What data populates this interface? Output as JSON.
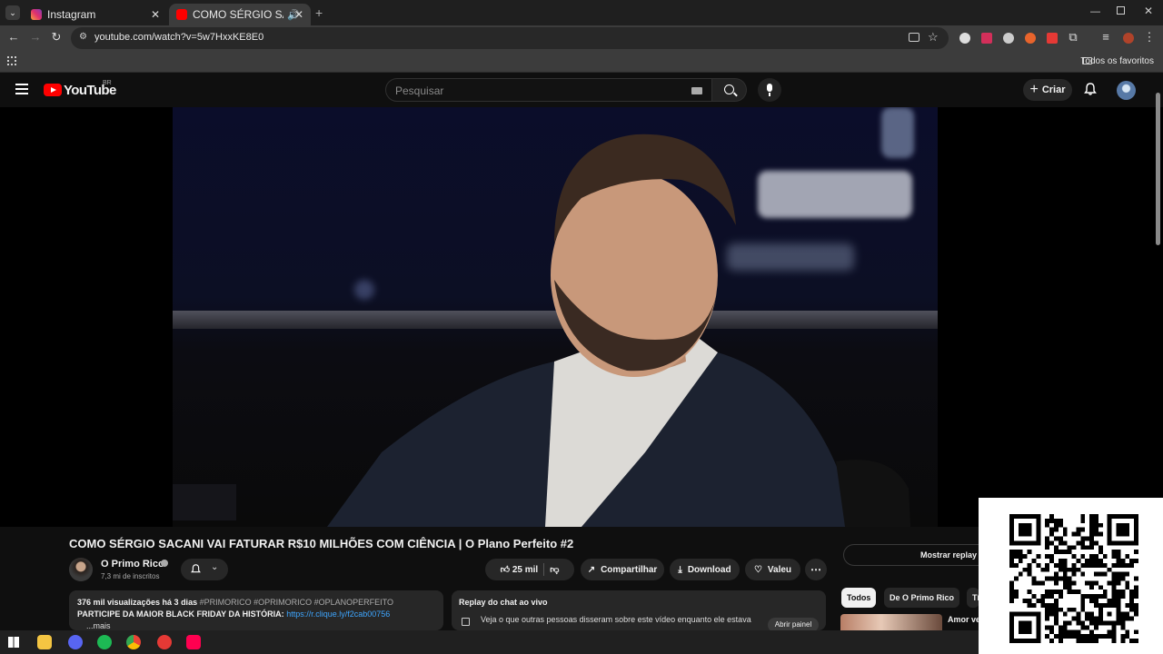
{
  "browser": {
    "tabs": [
      {
        "title": "Instagram",
        "active": false
      },
      {
        "title": "COMO SÉRGIO SACANI VAI",
        "active": true
      }
    ],
    "url": "youtube.com/watch?v=5w7HxxKE8E0",
    "bookmarks_folder": "Todos os favoritos"
  },
  "youtube": {
    "logo_text": "YouTube",
    "region": "BR",
    "search_placeholder": "Pesquisar",
    "create_label": "Criar"
  },
  "video": {
    "title": "COMO SÉRGIO SACANI VAI FATURAR R$10 MILHÕES COM CIÊNCIA | O Plano Perfeito #2",
    "channel": "O Primo Rico",
    "subscribers": "7,3 mi de inscritos",
    "likes": "25 mil",
    "share_label": "Compartilhar",
    "download_label": "Download",
    "thanks_label": "Valeu",
    "description": {
      "views_date": "376 mil visualizações  há 3 dias",
      "hashtags": "#PRIMORICO #OPRIMORICO #OPLANOPERFEITO",
      "line2_text": "PARTICIPE DA MAIOR BLACK FRIDAY DA HISTÓRIA: ",
      "link": "https://r.clique.ly/f2cab00756",
      "more": "...mais"
    }
  },
  "chat": {
    "title": "Replay do chat ao vivo",
    "description": "Veja o que outras pessoas disseram sobre este vídeo enquanto ele estava",
    "open_panel": "Abrir painel"
  },
  "sidebar": {
    "show_replay": "Mostrar replay d",
    "chips": [
      "Todos",
      "De O Primo Rico",
      "Tí"
    ],
    "rec_title": "Amor ve"
  },
  "colors": {
    "background": "#0f0f0f",
    "brand_red": "#ff0000",
    "link_blue": "#3ea6ff"
  }
}
